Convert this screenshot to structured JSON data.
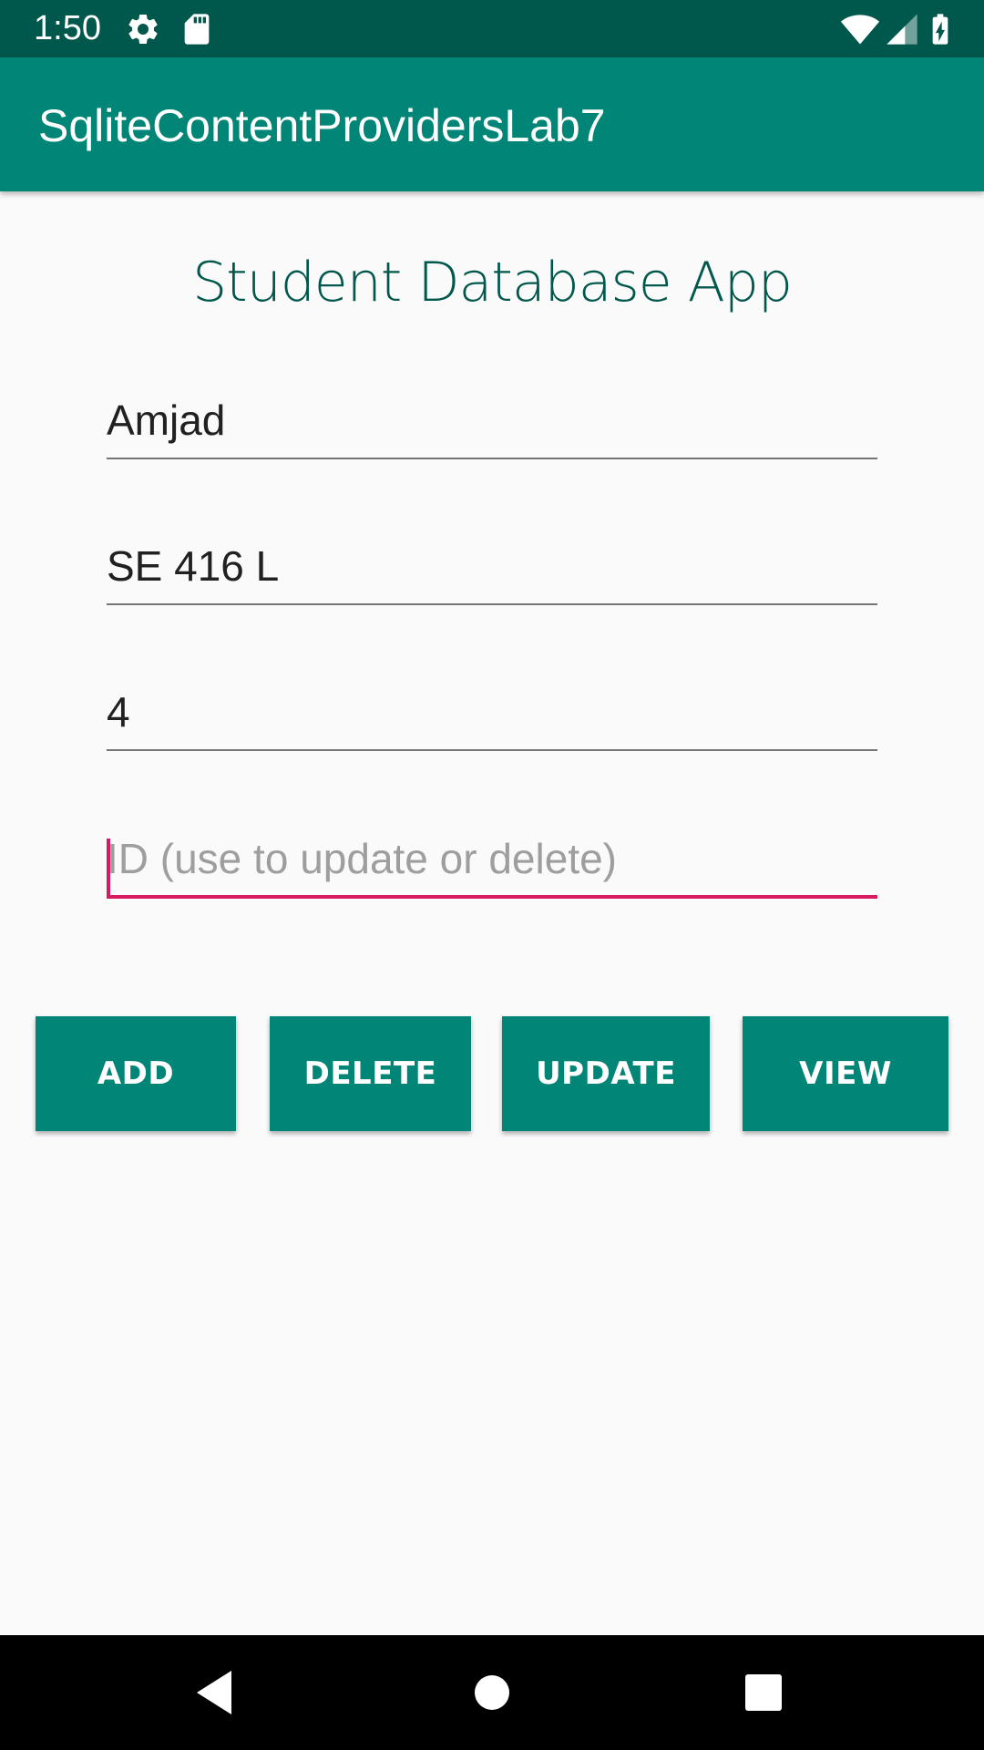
{
  "status_bar": {
    "time": "1:50",
    "icons": [
      "settings-icon",
      "sd-card-icon",
      "wifi-icon",
      "signal-icon",
      "battery-charging-icon"
    ]
  },
  "app_bar": {
    "title": "SqliteContentProvidersLab7"
  },
  "main": {
    "heading": "Student Database App",
    "fields": {
      "name": {
        "value": "Amjad"
      },
      "course": {
        "value": "SE 416 L"
      },
      "grade": {
        "value": "4"
      },
      "id": {
        "value": "",
        "placeholder": "ID (use to update or delete)"
      }
    },
    "buttons": {
      "add": "ADD",
      "delete": "DELETE",
      "update": "UPDATE",
      "view": "VIEW"
    }
  },
  "nav_bar": {
    "icons": [
      "back-icon",
      "home-icon",
      "recents-icon"
    ]
  },
  "colors": {
    "primary": "#008577",
    "primary_dark": "#00574b",
    "accent": "#d81b60",
    "background": "#fafafa"
  }
}
